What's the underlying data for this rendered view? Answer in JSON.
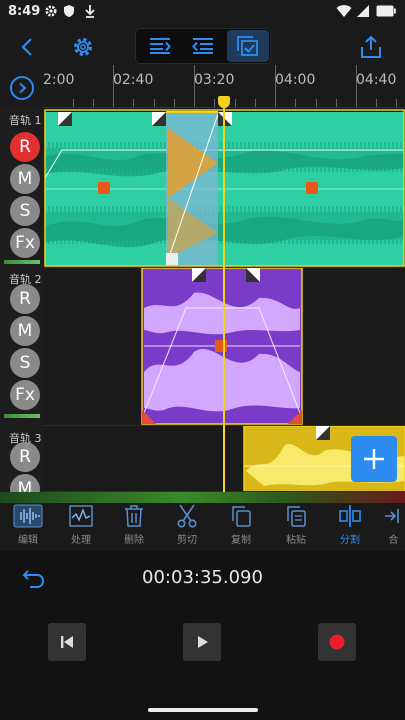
{
  "status": {
    "time": "8:49"
  },
  "ruler": {
    "ticks": [
      "2:00",
      "02:40",
      "03:20",
      "04:00",
      "04:40"
    ]
  },
  "tracks": [
    {
      "label": "音轨 1",
      "buttons": [
        "R",
        "M",
        "S",
        "Fx"
      ]
    },
    {
      "label": "音轨 2",
      "buttons": [
        "R",
        "M",
        "S",
        "Fx"
      ]
    },
    {
      "label": "音轨 3",
      "buttons": [
        "R",
        "M"
      ]
    }
  ],
  "tools": [
    {
      "label": "编辑",
      "icon": "waveform-edit-icon"
    },
    {
      "label": "处理",
      "icon": "waveform-process-icon"
    },
    {
      "label": "删除",
      "icon": "trash-icon"
    },
    {
      "label": "剪切",
      "icon": "scissors-icon"
    },
    {
      "label": "复制",
      "icon": "copy-icon"
    },
    {
      "label": "粘贴",
      "icon": "paste-icon"
    },
    {
      "label": "分割",
      "icon": "split-icon"
    },
    {
      "label": "合",
      "icon": "merge-icon"
    }
  ],
  "transport": {
    "time": "00:03:35.090"
  },
  "colors": {
    "accent": "#2d8cf0",
    "track1": "#2ecfa2",
    "track2": "#a855f7",
    "track3": "#e0c020",
    "playhead": "#f2d21b",
    "record": "#e03030"
  }
}
